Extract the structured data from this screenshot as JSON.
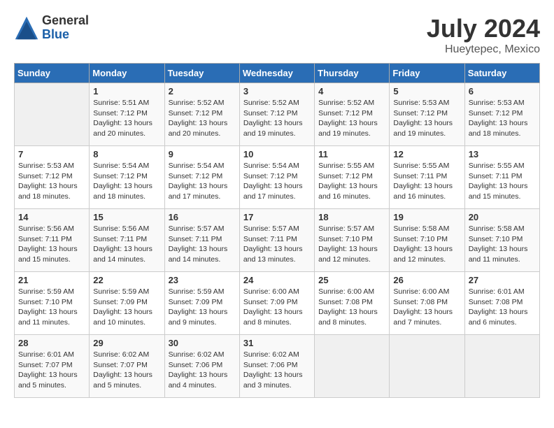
{
  "header": {
    "logo_general": "General",
    "logo_blue": "Blue",
    "title": "July 2024",
    "location": "Hueytepec, Mexico"
  },
  "days_of_week": [
    "Sunday",
    "Monday",
    "Tuesday",
    "Wednesday",
    "Thursday",
    "Friday",
    "Saturday"
  ],
  "weeks": [
    [
      {
        "day": "",
        "info": ""
      },
      {
        "day": "1",
        "info": "Sunrise: 5:51 AM\nSunset: 7:12 PM\nDaylight: 13 hours\nand 20 minutes."
      },
      {
        "day": "2",
        "info": "Sunrise: 5:52 AM\nSunset: 7:12 PM\nDaylight: 13 hours\nand 20 minutes."
      },
      {
        "day": "3",
        "info": "Sunrise: 5:52 AM\nSunset: 7:12 PM\nDaylight: 13 hours\nand 19 minutes."
      },
      {
        "day": "4",
        "info": "Sunrise: 5:52 AM\nSunset: 7:12 PM\nDaylight: 13 hours\nand 19 minutes."
      },
      {
        "day": "5",
        "info": "Sunrise: 5:53 AM\nSunset: 7:12 PM\nDaylight: 13 hours\nand 19 minutes."
      },
      {
        "day": "6",
        "info": "Sunrise: 5:53 AM\nSunset: 7:12 PM\nDaylight: 13 hours\nand 18 minutes."
      }
    ],
    [
      {
        "day": "7",
        "info": "Sunrise: 5:53 AM\nSunset: 7:12 PM\nDaylight: 13 hours\nand 18 minutes."
      },
      {
        "day": "8",
        "info": "Sunrise: 5:54 AM\nSunset: 7:12 PM\nDaylight: 13 hours\nand 18 minutes."
      },
      {
        "day": "9",
        "info": "Sunrise: 5:54 AM\nSunset: 7:12 PM\nDaylight: 13 hours\nand 17 minutes."
      },
      {
        "day": "10",
        "info": "Sunrise: 5:54 AM\nSunset: 7:12 PM\nDaylight: 13 hours\nand 17 minutes."
      },
      {
        "day": "11",
        "info": "Sunrise: 5:55 AM\nSunset: 7:12 PM\nDaylight: 13 hours\nand 16 minutes."
      },
      {
        "day": "12",
        "info": "Sunrise: 5:55 AM\nSunset: 7:11 PM\nDaylight: 13 hours\nand 16 minutes."
      },
      {
        "day": "13",
        "info": "Sunrise: 5:55 AM\nSunset: 7:11 PM\nDaylight: 13 hours\nand 15 minutes."
      }
    ],
    [
      {
        "day": "14",
        "info": "Sunrise: 5:56 AM\nSunset: 7:11 PM\nDaylight: 13 hours\nand 15 minutes."
      },
      {
        "day": "15",
        "info": "Sunrise: 5:56 AM\nSunset: 7:11 PM\nDaylight: 13 hours\nand 14 minutes."
      },
      {
        "day": "16",
        "info": "Sunrise: 5:57 AM\nSunset: 7:11 PM\nDaylight: 13 hours\nand 14 minutes."
      },
      {
        "day": "17",
        "info": "Sunrise: 5:57 AM\nSunset: 7:11 PM\nDaylight: 13 hours\nand 13 minutes."
      },
      {
        "day": "18",
        "info": "Sunrise: 5:57 AM\nSunset: 7:10 PM\nDaylight: 13 hours\nand 12 minutes."
      },
      {
        "day": "19",
        "info": "Sunrise: 5:58 AM\nSunset: 7:10 PM\nDaylight: 13 hours\nand 12 minutes."
      },
      {
        "day": "20",
        "info": "Sunrise: 5:58 AM\nSunset: 7:10 PM\nDaylight: 13 hours\nand 11 minutes."
      }
    ],
    [
      {
        "day": "21",
        "info": "Sunrise: 5:59 AM\nSunset: 7:10 PM\nDaylight: 13 hours\nand 11 minutes."
      },
      {
        "day": "22",
        "info": "Sunrise: 5:59 AM\nSunset: 7:09 PM\nDaylight: 13 hours\nand 10 minutes."
      },
      {
        "day": "23",
        "info": "Sunrise: 5:59 AM\nSunset: 7:09 PM\nDaylight: 13 hours\nand 9 minutes."
      },
      {
        "day": "24",
        "info": "Sunrise: 6:00 AM\nSunset: 7:09 PM\nDaylight: 13 hours\nand 8 minutes."
      },
      {
        "day": "25",
        "info": "Sunrise: 6:00 AM\nSunset: 7:08 PM\nDaylight: 13 hours\nand 8 minutes."
      },
      {
        "day": "26",
        "info": "Sunrise: 6:00 AM\nSunset: 7:08 PM\nDaylight: 13 hours\nand 7 minutes."
      },
      {
        "day": "27",
        "info": "Sunrise: 6:01 AM\nSunset: 7:08 PM\nDaylight: 13 hours\nand 6 minutes."
      }
    ],
    [
      {
        "day": "28",
        "info": "Sunrise: 6:01 AM\nSunset: 7:07 PM\nDaylight: 13 hours\nand 5 minutes."
      },
      {
        "day": "29",
        "info": "Sunrise: 6:02 AM\nSunset: 7:07 PM\nDaylight: 13 hours\nand 5 minutes."
      },
      {
        "day": "30",
        "info": "Sunrise: 6:02 AM\nSunset: 7:06 PM\nDaylight: 13 hours\nand 4 minutes."
      },
      {
        "day": "31",
        "info": "Sunrise: 6:02 AM\nSunset: 7:06 PM\nDaylight: 13 hours\nand 3 minutes."
      },
      {
        "day": "",
        "info": ""
      },
      {
        "day": "",
        "info": ""
      },
      {
        "day": "",
        "info": ""
      }
    ]
  ]
}
